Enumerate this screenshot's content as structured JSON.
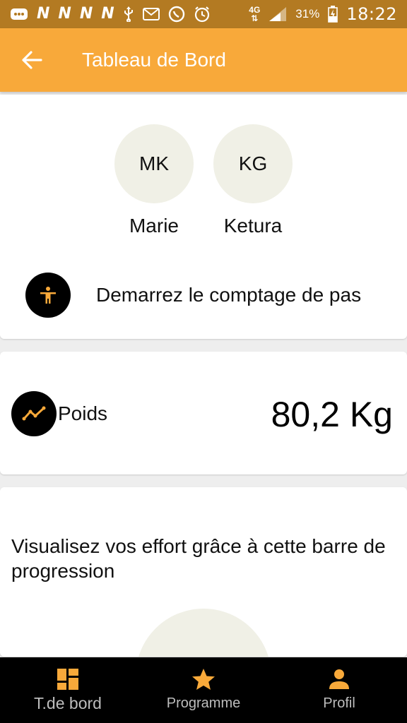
{
  "status_bar": {
    "notif_letters": [
      "N",
      "N",
      "N",
      "N"
    ],
    "network_label": "4G",
    "battery_percent": "31%",
    "time": "18:22"
  },
  "app_bar": {
    "title": "Tableau de Bord",
    "back_icon": "arrow-left-icon"
  },
  "members": [
    {
      "initials": "MK",
      "name": "Marie"
    },
    {
      "initials": "KG",
      "name": "Ketura"
    }
  ],
  "step_counter": {
    "label": "Demarrez le comptage de pas",
    "icon": "accessibility-person-icon"
  },
  "weight": {
    "label": "Poids",
    "value": "80,2 Kg",
    "icon": "trend-line-icon"
  },
  "progress": {
    "text": "Visualisez vos effort grâce à cette barre de progression"
  },
  "bottom_nav": {
    "items": [
      {
        "label": "T.de bord",
        "icon": "dashboard-icon",
        "active": true
      },
      {
        "label": "Programme",
        "icon": "star-icon",
        "active": false
      },
      {
        "label": "Profil",
        "icon": "person-icon",
        "active": false
      }
    ]
  },
  "colors": {
    "status_bar": "#b37a22",
    "app_bar": "#f8a93a",
    "accent_icon": "#f8a93a",
    "avatar_bg": "#f0f0e6",
    "bottom_nav_bg": "#000000"
  }
}
